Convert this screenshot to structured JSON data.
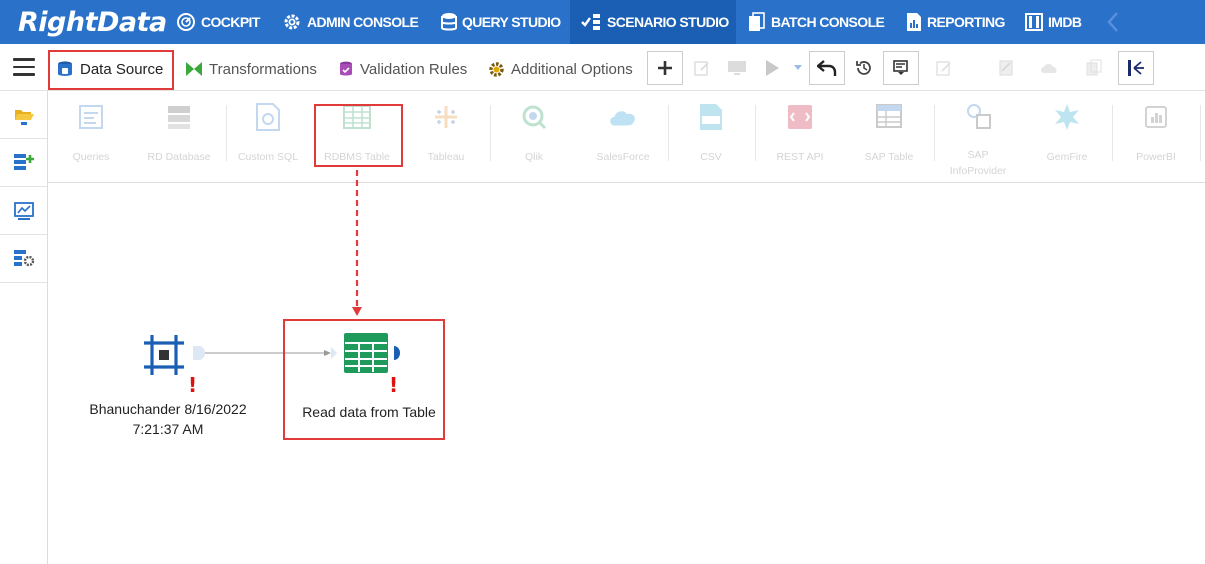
{
  "app": {
    "logo_text": "RightData",
    "brand_color": "#2a72c9",
    "active_color": "#1a5fb4",
    "highlight_color": "#e03a3a"
  },
  "nav": {
    "items": [
      {
        "label": "COCKPIT",
        "icon": "speedometer-icon"
      },
      {
        "label": "ADMIN CONSOLE",
        "icon": "gear-icon"
      },
      {
        "label": "QUERY STUDIO",
        "icon": "database-icon"
      },
      {
        "label": "SCENARIO STUDIO",
        "icon": "scenario-flow-icon",
        "active": true
      },
      {
        "label": "BATCH CONSOLE",
        "icon": "batch-files-icon"
      },
      {
        "label": "REPORTING",
        "icon": "report-chart-icon"
      },
      {
        "label": "IMDB",
        "icon": "columns-icon"
      }
    ],
    "collapse_icon": "chevron-left-icon"
  },
  "toolbar": {
    "menu_icon": "hamburger-menu-icon",
    "tabs": [
      {
        "label": "Data Source",
        "icon": "data-source-icon",
        "selected": true
      },
      {
        "label": "Transformations",
        "icon": "bowtie-icon"
      },
      {
        "label": "Validation Rules",
        "icon": "validation-db-icon"
      },
      {
        "label": "Additional Options",
        "icon": "cog-icon"
      }
    ],
    "buttons": [
      {
        "name": "add",
        "icon": "plus-icon",
        "enabled": true
      },
      {
        "name": "edit",
        "icon": "edit-icon",
        "enabled": false
      },
      {
        "name": "preview",
        "icon": "monitor-icon",
        "enabled": false
      },
      {
        "name": "run",
        "icon": "play-icon",
        "enabled": false
      },
      {
        "name": "run-options",
        "icon": "caret-down-icon",
        "enabled": false
      },
      {
        "name": "undo",
        "icon": "undo-arrow-icon",
        "enabled": true
      },
      {
        "name": "history",
        "icon": "history-icon",
        "enabled": true
      },
      {
        "name": "schedule",
        "icon": "schedule-icon",
        "enabled": true
      },
      {
        "name": "notes",
        "icon": "note-icon",
        "enabled": false
      },
      {
        "name": "properties",
        "icon": "document-edit-icon",
        "enabled": false
      },
      {
        "name": "share",
        "icon": "cloud-icon",
        "enabled": false
      },
      {
        "name": "copy",
        "icon": "copy-icon",
        "enabled": false
      },
      {
        "name": "collapse-panel",
        "icon": "collapse-panel-icon",
        "enabled": true
      }
    ]
  },
  "rail": {
    "items": [
      {
        "name": "open-folder",
        "icon": "folder-open-icon"
      },
      {
        "name": "add-scenario",
        "icon": "add-node-icon"
      },
      {
        "name": "dashboard",
        "icon": "dashboard-icon"
      },
      {
        "name": "scenario-settings",
        "icon": "settings-node-icon"
      }
    ]
  },
  "sources": [
    {
      "label": "Queries",
      "icon": "queries-icon"
    },
    {
      "label": "RD Database",
      "icon": "rd-database-icon"
    },
    {
      "label": "Custom SQL",
      "icon": "custom-sql-icon"
    },
    {
      "label": "RDBMS Table",
      "icon": "table-icon",
      "highlighted": true
    },
    {
      "label": "Tableau",
      "icon": "tableau-icon"
    },
    {
      "label": "Qlik",
      "icon": "qlik-icon"
    },
    {
      "label": "SalesForce",
      "icon": "salesforce-cloud-icon"
    },
    {
      "label": "CSV",
      "icon": "csv-file-icon"
    },
    {
      "label": "REST API",
      "icon": "rest-api-icon"
    },
    {
      "label": "SAP Table",
      "icon": "sap-table-icon"
    },
    {
      "label": "SAP InfoProvider",
      "icon": "sap-infoprovider-icon"
    },
    {
      "label": "GemFire",
      "icon": "gemfire-icon"
    },
    {
      "label": "PowerBI",
      "icon": "powerbi-icon"
    }
  ],
  "canvas": {
    "nodes": [
      {
        "id": "start",
        "label": "Bhanuchander 8/16/2022 7:21:37 AM",
        "label_line1": "Bhanuchander 8/16/2022",
        "label_line2": "7:21:37 AM",
        "icon": "crop-frame-icon",
        "warning": "!"
      },
      {
        "id": "read-table",
        "label": "Read data from Table",
        "icon": "table-grid-icon",
        "warning": "!"
      }
    ],
    "edge": {
      "from": "start",
      "to": "read-table"
    }
  }
}
